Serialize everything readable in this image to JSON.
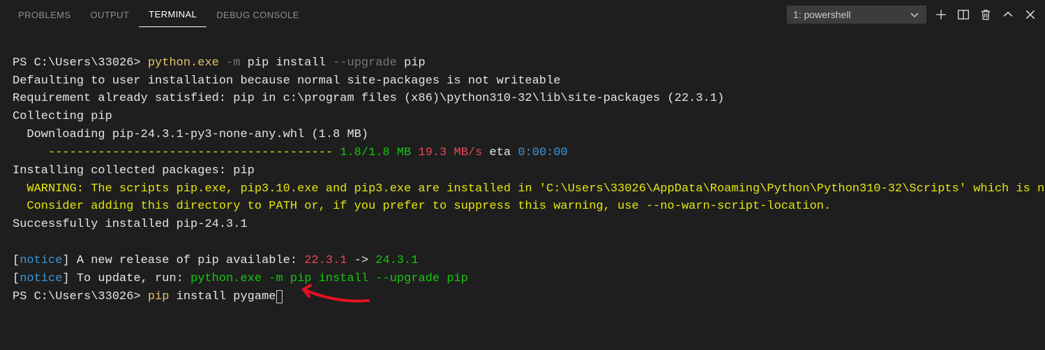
{
  "tabs": {
    "problems": "PROBLEMS",
    "output": "OUTPUT",
    "terminal": "TERMINAL",
    "debug_console": "DEBUG CONSOLE"
  },
  "selector": {
    "label": "1: powershell"
  },
  "term": {
    "prompt1": "PS C:\\Users\\33026> ",
    "cmd1_a": "python.exe",
    "cmd1_b": " -m",
    "cmd1_c": " pip install ",
    "cmd1_d": "--upgrade",
    "cmd1_e": " pip",
    "line2": "Defaulting to user installation because normal site-packages is not writeable",
    "line3": "Requirement already satisfied: pip in c:\\program files (x86)\\python310-32\\lib\\site-packages (22.3.1)",
    "line4": "Collecting pip",
    "line5": "  Downloading pip-24.3.1-py3-none-any.whl (1.8 MB)",
    "line6_dashes": "     ---------------------------------------- ",
    "line6_size": "1.8/1.8 MB",
    "line6_speed": " 19.3 MB/s",
    "line6_eta": " eta ",
    "line6_time": "0:00:00",
    "line7": "Installing collected packages: pip",
    "warn1": "  WARNING: The scripts pip.exe, pip3.10.exe and pip3.exe are installed in 'C:\\Users\\33026\\AppData\\Roaming\\Python\\Python310-32\\Scripts' which is not on PATH.",
    "warn2": "  Consider adding this directory to PATH or, if you prefer to suppress this warning, use --no-warn-script-location.",
    "line10": "Successfully installed pip-24.3.1",
    "blank": "",
    "notice_open": "[",
    "notice_label": "notice",
    "notice_close": "]",
    "notice1_text": " A new release of pip available: ",
    "notice1_old": "22.3.1",
    "notice1_arrow": " -> ",
    "notice1_new": "24.3.1",
    "notice2_text": " To update, run: ",
    "notice2_cmd": "python.exe -m pip install --upgrade pip",
    "prompt2": "PS C:\\Users\\33026> ",
    "cmd2_a": "pip",
    "cmd2_b": " install pygame"
  }
}
